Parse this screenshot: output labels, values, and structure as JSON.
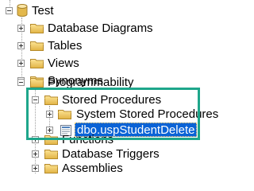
{
  "tree": {
    "root": {
      "label": "Test",
      "expanded": true,
      "icon": "database-icon"
    },
    "items": [
      {
        "label": "Database Diagrams",
        "expanded": false,
        "icon": "folder-icon"
      },
      {
        "label": "Tables",
        "expanded": false,
        "icon": "folder-icon"
      },
      {
        "label": "Views",
        "expanded": false,
        "icon": "folder-icon"
      },
      {
        "label": "Synonyms",
        "expanded": false,
        "icon": "folder-icon"
      },
      {
        "label": "Programmability",
        "expanded": true,
        "icon": "folder-icon"
      }
    ],
    "programmability": {
      "stored_procedures": {
        "label": "Stored Procedures",
        "expanded": true,
        "icon": "folder-icon"
      },
      "system_stored_procedures": {
        "label": "System Stored Procedures",
        "expanded": false,
        "icon": "folder-icon"
      },
      "selected_procedure": {
        "label": "dbo.uspStudentDelete",
        "expanded": false,
        "icon": "stored-procedure-icon",
        "selected": true
      },
      "functions": {
        "label": "Functions",
        "expanded": false,
        "icon": "folder-icon"
      },
      "database_triggers": {
        "label": "Database Triggers",
        "expanded": false,
        "icon": "folder-icon"
      },
      "assemblies": {
        "label": "Assemblies",
        "expanded": false,
        "icon": "folder-icon"
      }
    }
  },
  "colors": {
    "selection_bg": "#0a63d6",
    "highlight_border": "#1ea68b",
    "folder": "#e8c25a"
  }
}
